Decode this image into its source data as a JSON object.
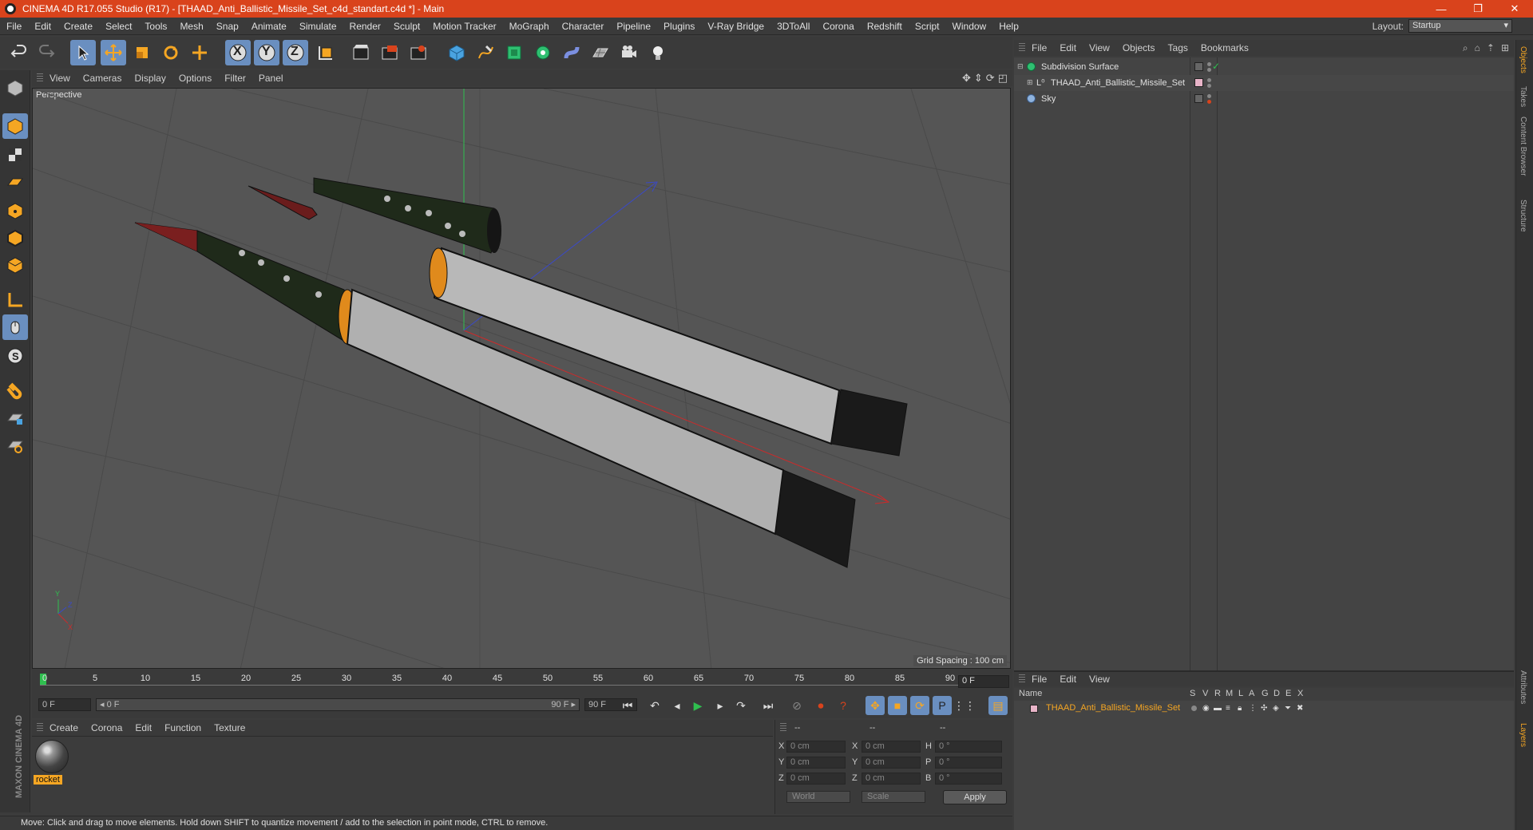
{
  "window": {
    "title": "CINEMA 4D R17.055 Studio (R17) - [THAAD_Anti_Ballistic_Missile_Set_c4d_standart.c4d *] - Main",
    "minimize": "—",
    "restore": "❐",
    "close": "✕"
  },
  "menu": {
    "items": [
      "File",
      "Edit",
      "Create",
      "Select",
      "Tools",
      "Mesh",
      "Snap",
      "Animate",
      "Simulate",
      "Render",
      "Sculpt",
      "Motion Tracker",
      "MoGraph",
      "Character",
      "Pipeline",
      "Plugins",
      "V-Ray Bridge",
      "3DToAll",
      "Corona",
      "Redshift",
      "Script",
      "Window",
      "Help"
    ],
    "layout_label": "Layout:",
    "layout_value": "Startup"
  },
  "toolbar": {
    "icons": [
      "undo-icon",
      "redo-icon",
      "live-select-icon",
      "move-icon",
      "scale-icon",
      "rotate-icon",
      "last-tool-icon",
      "x-axis-lock",
      "y-axis-lock",
      "z-axis-lock",
      "coordinate-system-icon",
      "render-view-icon",
      "render-picture-viewer-icon",
      "edit-render-settings-icon",
      "cube-icon",
      "pen-spline-icon",
      "subdivision-nurbs-icon",
      "cloner-icon",
      "deformer-icon",
      "floor-icon",
      "camera-icon",
      "light-icon"
    ],
    "x_label": "X",
    "y_label": "Y",
    "z_label": "Z"
  },
  "viewport": {
    "menu": [
      "View",
      "Cameras",
      "Display",
      "Options",
      "Filter",
      "Panel"
    ],
    "camera_label": "Perspective",
    "grid_spacing": "Grid Spacing : 100 cm",
    "axis_y": "Y",
    "axis_z": "Z",
    "axis_x": "X"
  },
  "timeline": {
    "ticks": [
      "0",
      "5",
      "10",
      "15",
      "20",
      "25",
      "30",
      "35",
      "40",
      "45",
      "50",
      "55",
      "60",
      "65",
      "70",
      "75",
      "80",
      "85",
      "90"
    ],
    "current_frame": "0 F",
    "start_field": "0 F",
    "range_start": "◂ 0 F",
    "range_end": "90 F ▸",
    "end_field": "90 F"
  },
  "materials": {
    "menu": [
      "Create",
      "Corona",
      "Edit",
      "Function",
      "Texture"
    ],
    "items": [
      {
        "name": "rocket"
      }
    ]
  },
  "coordinates": {
    "headers": [
      "--",
      "--",
      "--"
    ],
    "rows": [
      {
        "axis": "X",
        "pos": "0 cm",
        "axis2": "X",
        "size": "0 cm",
        "rot_label": "H",
        "rot": "0 °"
      },
      {
        "axis": "Y",
        "pos": "0 cm",
        "axis2": "Y",
        "size": "0 cm",
        "rot_label": "P",
        "rot": "0 °"
      },
      {
        "axis": "Z",
        "pos": "0 cm",
        "axis2": "Z",
        "size": "0 cm",
        "rot_label": "B",
        "rot": "0 °"
      }
    ],
    "mode_world": "World",
    "mode_scale": "Scale",
    "apply": "Apply"
  },
  "status": {
    "text": "Move: Click and drag to move elements. Hold down SHIFT to quantize movement / add to the selection in point mode, CTRL to remove."
  },
  "object_manager": {
    "menu": [
      "File",
      "Edit",
      "View",
      "Objects",
      "Tags",
      "Bookmarks"
    ],
    "objects": [
      {
        "name": "Subdivision Surface",
        "indent": 0
      },
      {
        "name": "THAAD_Anti_Ballistic_Missile_Set",
        "indent": 1
      },
      {
        "name": "Sky",
        "indent": 0
      }
    ]
  },
  "layer_manager": {
    "menu": [
      "File",
      "Edit",
      "View"
    ],
    "columns": [
      "Name",
      "S",
      "V",
      "R",
      "M",
      "L",
      "A",
      "G",
      "D",
      "E",
      "X"
    ],
    "layers": [
      {
        "name": "THAAD_Anti_Ballistic_Missile_Set",
        "color": "#f5a623"
      }
    ]
  },
  "right_tabs": [
    "Objects",
    "Takes",
    "Content Browser",
    "Structure",
    "Attributes",
    "Layers"
  ],
  "brand": {
    "text": "MAXON CINEMA 4D"
  },
  "colors": {
    "accent": "#6a8fc0",
    "title_bar": "#d9431c",
    "highlight": "#f5a623"
  }
}
